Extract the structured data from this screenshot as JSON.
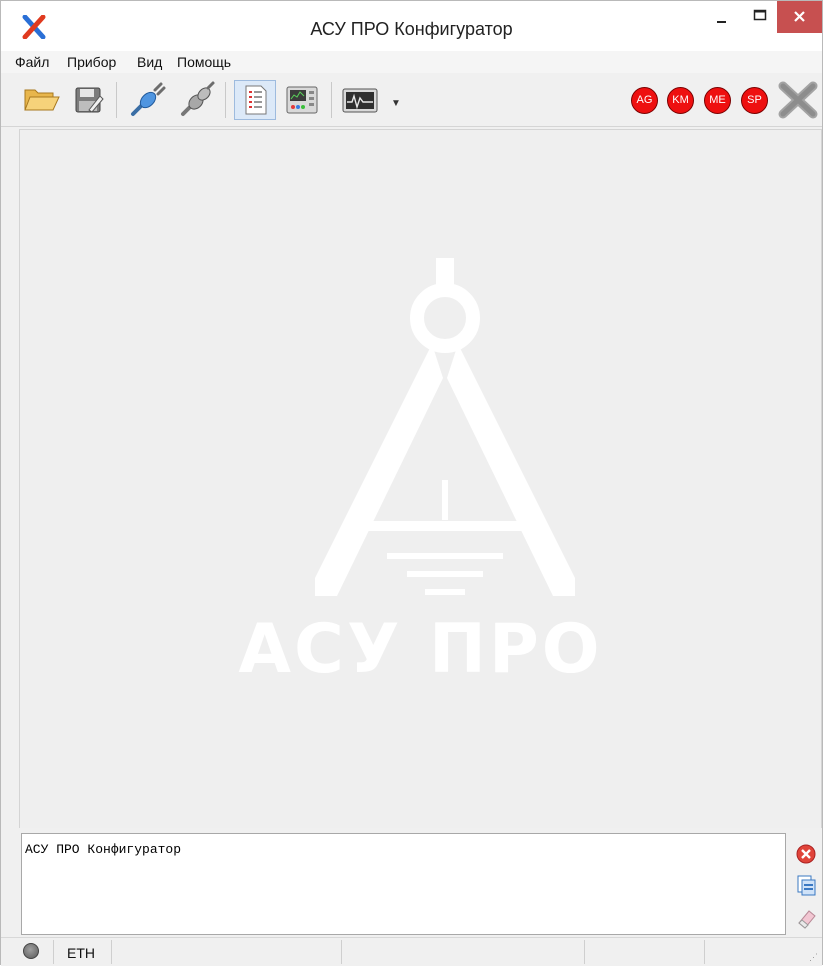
{
  "window": {
    "title": "АСУ ПРО Конфигуратор"
  },
  "menu": {
    "items": [
      "Файл",
      "Прибор",
      "Вид",
      "Помощь"
    ]
  },
  "toolbar": {
    "buttons": [
      "open-folder-icon",
      "save-icon",
      "connect-icon",
      "disconnect-icon",
      "report-icon",
      "device-panel-icon",
      "oscilloscope-icon"
    ],
    "indicators": [
      "AG",
      "KM",
      "ME",
      "SP"
    ],
    "indicator_color": "#ee1010"
  },
  "watermark": {
    "text": "АСУ ПРО"
  },
  "log": {
    "text": "АСУ ПРО Конфигуратор"
  },
  "statusbar": {
    "connection": "ETH"
  }
}
